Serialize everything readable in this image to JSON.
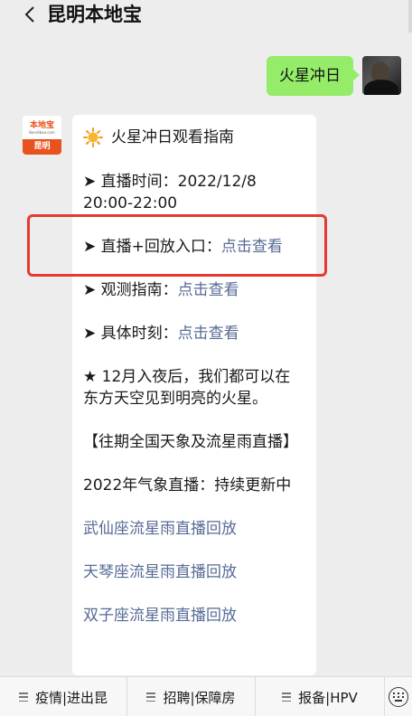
{
  "header": {
    "title": "昆明本地宝"
  },
  "sent_message": {
    "text": "火星冲日"
  },
  "bot_avatar": {
    "line1": "本地宝",
    "line2": "Bendibao.com",
    "city": "昆明"
  },
  "card": {
    "title": "火星冲日观看指南",
    "items": [
      {
        "prefix": "➤ 直播时间：2022/12/8 20:00-22:00",
        "link": ""
      },
      {
        "prefix": "➤ 直播+回放入口：",
        "link": "点击查看"
      },
      {
        "prefix": "➤ 观测指南：",
        "link": "点击查看"
      },
      {
        "prefix": "➤ 具体时刻：",
        "link": "点击查看"
      }
    ],
    "note": "★ 12月入夜后，我们都可以在东方天空见到明亮的火星。",
    "section_title": "【往期全国天象及流星雨直播】",
    "update_text": "2022年气象直播：持续更新中",
    "replays": [
      "武仙座流星雨直播回放",
      "天琴座流星雨直播回放",
      "双子座流星雨直播回放"
    ]
  },
  "bottom_menu": [
    {
      "label": "疫情|进出昆"
    },
    {
      "label": "招聘|保障房"
    },
    {
      "label": "报备|HPV"
    }
  ],
  "colors": {
    "link": "#576b95",
    "bubble": "#95ec69",
    "highlight": "#e53935",
    "brand": "#e8531d"
  }
}
